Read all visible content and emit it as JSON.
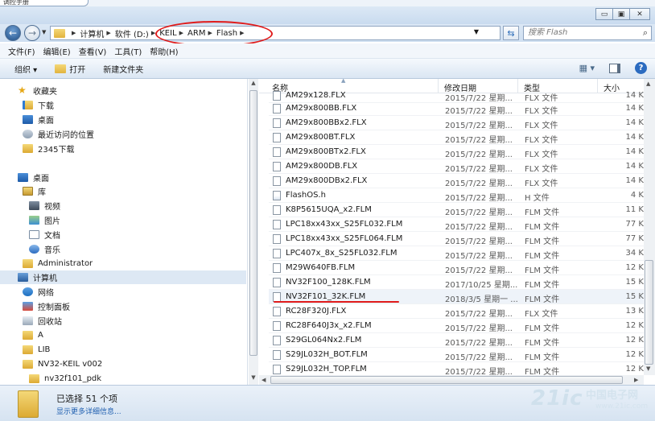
{
  "top_tab": "调控手册",
  "window_buttons": {
    "minimize": "▭",
    "maximize": "▣",
    "close": "✕"
  },
  "address": {
    "crumbs": [
      "计算机",
      "软件 (D:)",
      "KEIL",
      "ARM",
      "Flash"
    ],
    "search_placeholder": "搜索 Flash"
  },
  "menu": [
    "文件(F)",
    "编辑(E)",
    "查看(V)",
    "工具(T)",
    "帮助(H)"
  ],
  "toolbar": {
    "organize": "组织 ▾",
    "open": "打开",
    "new_folder": "新建文件夹"
  },
  "nav": {
    "favorites": "收藏夹",
    "downloads": "下载",
    "desktop_fav": "桌面",
    "recent": "最近访问的位置",
    "dl2345": "2345下载",
    "desktop": "桌面",
    "library": "库",
    "video": "视频",
    "pictures": "图片",
    "documents": "文档",
    "music": "音乐",
    "admin": "Administrator",
    "computer": "计算机",
    "network": "网络",
    "control_panel": "控制面板",
    "recycle": "回收站",
    "a": "A",
    "lib": "LIB",
    "nv32keil": "NV32-KEIL v002",
    "pdk": "nv32f101_pdk"
  },
  "columns": {
    "name": "名称",
    "date": "修改日期",
    "type": "类型",
    "size": "大小"
  },
  "files": [
    {
      "name": "AM29x128.FLX",
      "date": "2015/7/22 星期...",
      "type": "FLX 文件",
      "size": "14 K"
    },
    {
      "name": "AM29x800BB.FLX",
      "date": "2015/7/22 星期...",
      "type": "FLX 文件",
      "size": "14 K"
    },
    {
      "name": "AM29x800BBx2.FLX",
      "date": "2015/7/22 星期...",
      "type": "FLX 文件",
      "size": "14 K"
    },
    {
      "name": "AM29x800BT.FLX",
      "date": "2015/7/22 星期...",
      "type": "FLX 文件",
      "size": "14 K"
    },
    {
      "name": "AM29x800BTx2.FLX",
      "date": "2015/7/22 星期...",
      "type": "FLX 文件",
      "size": "14 K"
    },
    {
      "name": "AM29x800DB.FLX",
      "date": "2015/7/22 星期...",
      "type": "FLX 文件",
      "size": "14 K"
    },
    {
      "name": "AM29x800DBx2.FLX",
      "date": "2015/7/22 星期...",
      "type": "FLX 文件",
      "size": "14 K"
    },
    {
      "name": "FlashOS.h",
      "date": "2015/7/22 星期...",
      "type": "H 文件",
      "size": "4 K"
    },
    {
      "name": "K8P5615UQA_x2.FLM",
      "date": "2015/7/22 星期...",
      "type": "FLM 文件",
      "size": "11 K"
    },
    {
      "name": "LPC18xx43xx_S25FL032.FLM",
      "date": "2015/7/22 星期...",
      "type": "FLM 文件",
      "size": "77 K"
    },
    {
      "name": "LPC18xx43xx_S25FL064.FLM",
      "date": "2015/7/22 星期...",
      "type": "FLM 文件",
      "size": "77 K"
    },
    {
      "name": "LPC407x_8x_S25FL032.FLM",
      "date": "2015/7/22 星期...",
      "type": "FLM 文件",
      "size": "34 K"
    },
    {
      "name": "M29W640FB.FLM",
      "date": "2015/7/22 星期...",
      "type": "FLM 文件",
      "size": "12 K"
    },
    {
      "name": "NV32F100_128K.FLM",
      "date": "2017/10/25 星期...",
      "type": "FLM 文件",
      "size": "15 K"
    },
    {
      "name": "NV32F101_32K.FLM",
      "date": "2018/3/5 星期一 ...",
      "type": "FLM 文件",
      "size": "15 K"
    },
    {
      "name": "RC28F320J.FLX",
      "date": "2015/7/22 星期...",
      "type": "FLX 文件",
      "size": "13 K"
    },
    {
      "name": "RC28F640J3x_x2.FLM",
      "date": "2015/7/22 星期...",
      "type": "FLM 文件",
      "size": "12 K"
    },
    {
      "name": "S29GL064Nx2.FLM",
      "date": "2015/7/22 星期...",
      "type": "FLM 文件",
      "size": "12 K"
    },
    {
      "name": "S29JL032H_BOT.FLM",
      "date": "2015/7/22 星期...",
      "type": "FLM 文件",
      "size": "12 K"
    },
    {
      "name": "S29JL032H_TOP.FLM",
      "date": "2015/7/22 星期...",
      "type": "FLM 文件",
      "size": "12 K"
    }
  ],
  "status": {
    "selected": "已选择 51 个项",
    "more": "显示更多详细信息..."
  },
  "watermark": {
    "logo": "21ic",
    "cn": "中国电子网",
    "url": "www.21ic.com"
  }
}
